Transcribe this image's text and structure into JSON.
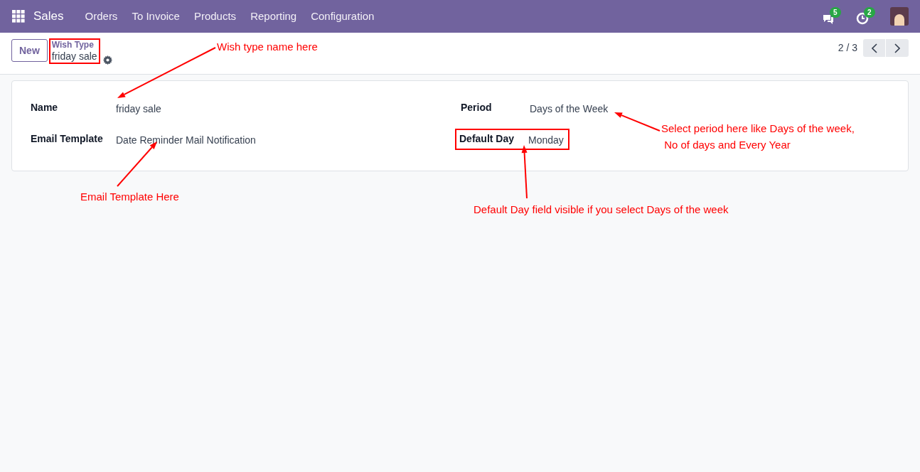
{
  "navbar": {
    "app": "Sales",
    "menu": [
      "Orders",
      "To Invoice",
      "Products",
      "Reporting",
      "Configuration"
    ],
    "systray": [
      {
        "kind": "chat",
        "badge": "5"
      },
      {
        "kind": "activity",
        "badge": "2"
      }
    ]
  },
  "control_panel": {
    "new_button": "New",
    "breadcrumb": "Wish Type",
    "record": "friday sale",
    "highlighted": true,
    "pager": "2 / 3"
  },
  "form": {
    "left": [
      {
        "label": "Name",
        "value": "friday sale",
        "highlighted": false
      },
      {
        "label": "Email Template",
        "value": "Date Reminder Mail Notification",
        "highlighted": false
      }
    ],
    "right": [
      {
        "label": "Period",
        "value": "Days of the Week",
        "highlighted": false
      },
      {
        "label": "Default Day",
        "value": "Monday",
        "highlighted": true
      }
    ]
  },
  "annotations": [
    {
      "lines": [
        "Wish type name here"
      ]
    },
    {
      "lines": [
        "Email Template Here"
      ]
    },
    {
      "lines": [
        "Select period here like Days of the week,",
        " No of days and Every Year"
      ]
    },
    {
      "lines": [
        "Default Day field visible if you select Days of the week"
      ]
    }
  ]
}
